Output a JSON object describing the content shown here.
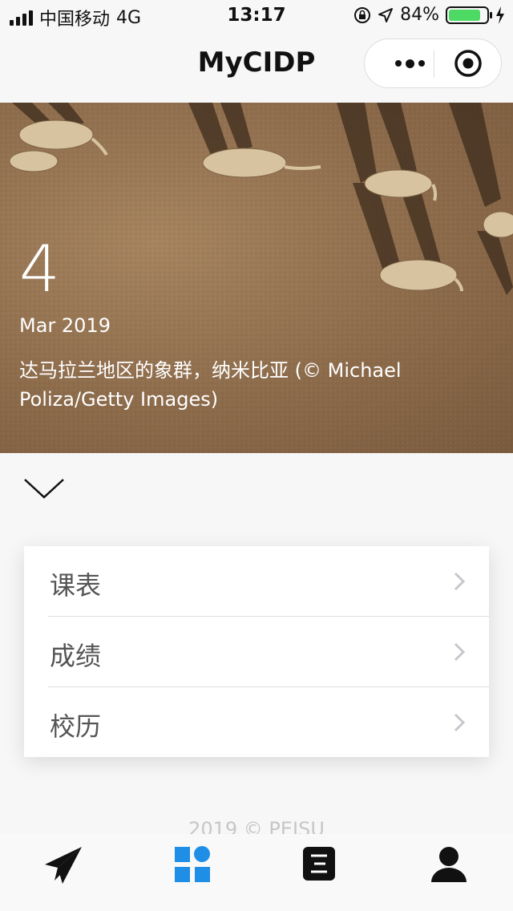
{
  "status_bar": {
    "carrier": "中国移动",
    "network": "4G",
    "time": "13:17",
    "battery_percent": "84%",
    "battery_level": 0.84
  },
  "nav": {
    "title": "MyCIDP",
    "more_icon": "ellipsis-icon",
    "close_icon": "target-icon"
  },
  "hero": {
    "day": "4",
    "month_year": "Mar 2019",
    "caption": "达马拉兰地区的象群，纳米比亚 (© Michael Poliza/Getty Images)"
  },
  "menu": {
    "items": [
      {
        "label": "课表"
      },
      {
        "label": "成绩"
      },
      {
        "label": "校历"
      }
    ]
  },
  "footer": {
    "text": "2019 © PEISU"
  },
  "tabbar": {
    "active_color": "#1e8ee6",
    "items": [
      {
        "icon": "paper-plane-icon"
      },
      {
        "icon": "grid-icon"
      },
      {
        "icon": "document-icon"
      },
      {
        "icon": "user-icon"
      }
    ]
  }
}
